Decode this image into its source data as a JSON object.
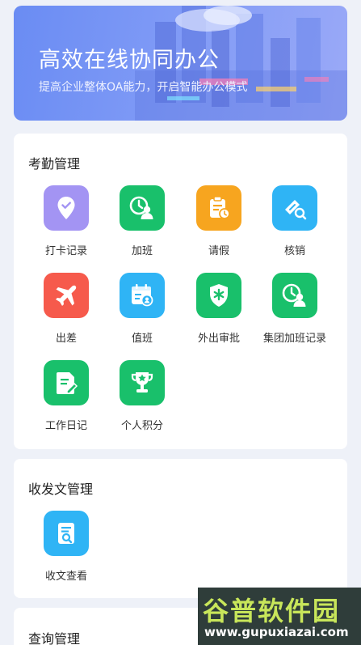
{
  "banner": {
    "title": "高效在线协同办公",
    "subtitle": "提高企业整体OA能力，开启智能办公模式"
  },
  "sections": {
    "attendance": {
      "title": "考勤管理",
      "items": [
        {
          "label": "打卡记录",
          "icon": "location-check-icon",
          "color": "#a394f3"
        },
        {
          "label": "加班",
          "icon": "clock-person-icon",
          "color": "#19c06b"
        },
        {
          "label": "请假",
          "icon": "clipboard-clock-icon",
          "color": "#f7a51f"
        },
        {
          "label": "核销",
          "icon": "ticket-search-icon",
          "color": "#2fb4f5"
        },
        {
          "label": "出差",
          "icon": "airplane-icon",
          "color": "#f65a4c"
        },
        {
          "label": "值班",
          "icon": "calendar-person-icon",
          "color": "#2fb4f5"
        },
        {
          "label": "外出审批",
          "icon": "shield-asterisk-icon",
          "color": "#19c06b"
        },
        {
          "label": "集团加班记录",
          "icon": "clock-person-icon",
          "color": "#19c06b"
        },
        {
          "label": "工作日记",
          "icon": "document-edit-icon",
          "color": "#19c06b"
        },
        {
          "label": "个人积分",
          "icon": "trophy-icon",
          "color": "#19c06b"
        }
      ]
    },
    "documents": {
      "title": "收发文管理",
      "items": [
        {
          "label": "收文查看",
          "icon": "document-search-icon",
          "color": "#2fb4f5"
        }
      ]
    },
    "query": {
      "title": "查询管理"
    }
  },
  "watermark": {
    "title": "谷普软件园",
    "url": "www.gupuxiazai.com"
  }
}
